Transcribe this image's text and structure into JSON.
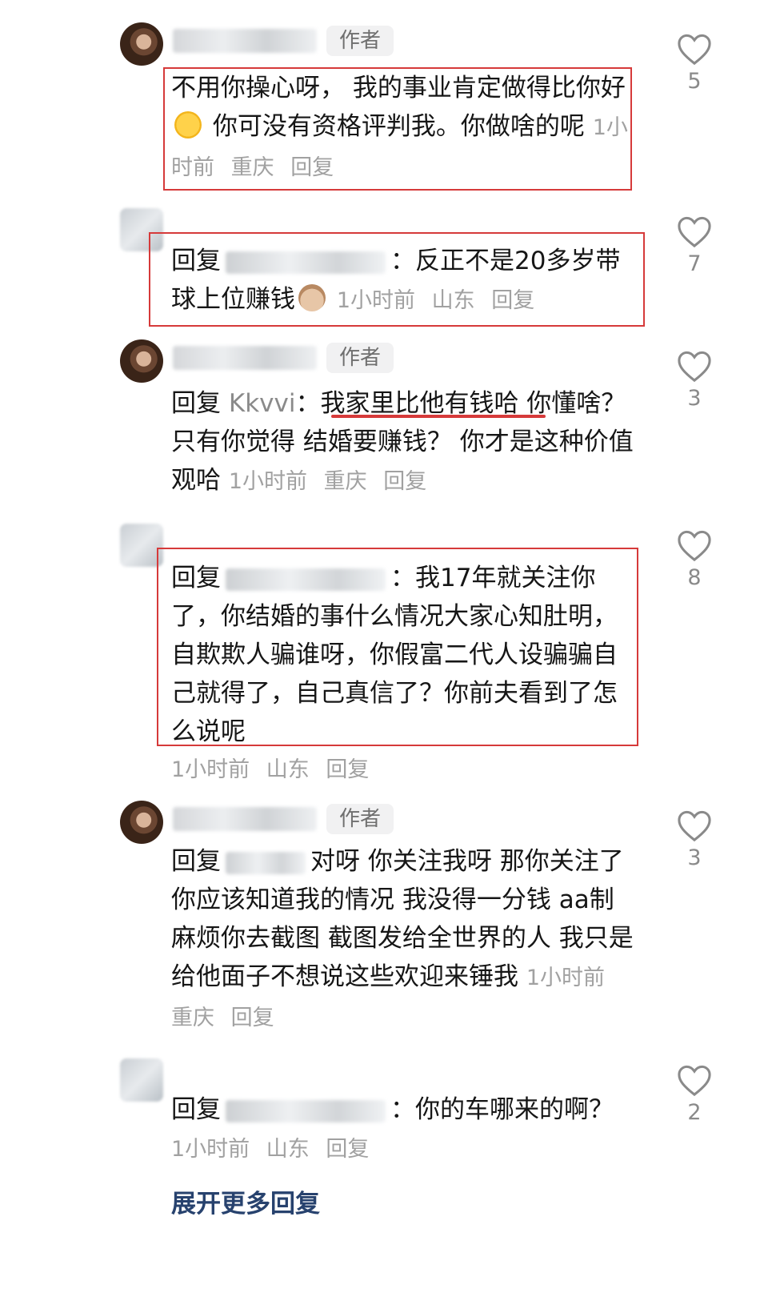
{
  "comments": [
    {
      "is_author": true,
      "author_badge": "作者",
      "reply_prefix": "",
      "text": "不用你操心呀， 我的事业肯定做得比你好",
      "emoji": "thinking-face-icon",
      "text_after_emoji": " 你可没有资格评判我。你做啥的呢",
      "time": "1小时前",
      "location": "重庆",
      "reply_label": "回复",
      "likes": "5"
    },
    {
      "is_author": false,
      "reply_prefix": "回复",
      "text": "：反正不是20多岁带球上位赚钱",
      "emoji": "poop-face-icon",
      "time": "1小时前",
      "location": "山东",
      "reply_label": "回复",
      "likes": "7"
    },
    {
      "is_author": true,
      "author_badge": "作者",
      "reply_prefix": "回复",
      "mention": "Kkvvi",
      "text": "：我家里比他有钱哈 你懂啥？ 只有你觉得 结婚要赚钱？ 你才是这种价值观哈",
      "time": "1小时前",
      "location": "重庆",
      "reply_label": "回复",
      "likes": "3"
    },
    {
      "is_author": false,
      "reply_prefix": "回复",
      "text": "：我17年就关注你了，你结婚的事什么情况大家心知肚明，自欺欺人骗谁呀，你假富二代人设骗骗自己就得了，自己真信了？你前夫看到了怎么说呢",
      "time": "1小时前",
      "location": "山东",
      "reply_label": "回复",
      "likes": "8"
    },
    {
      "is_author": true,
      "author_badge": "作者",
      "reply_prefix": "回复",
      "text": "对呀 你关注我呀 那你关注了你应该知道我的情况 我没得一分钱 aa制 麻烦你去截图 截图发给全世界的人 我只是给他面子不想说这些欢迎来锤我",
      "time": "1小时前",
      "location": "重庆",
      "reply_label": "回复",
      "likes": "3"
    },
    {
      "is_author": false,
      "reply_prefix": "回复",
      "text": "：你的车哪来的啊？",
      "time": "1小时前",
      "location": "山东",
      "reply_label": "回复",
      "likes": "2"
    }
  ],
  "expand_more": "展开更多回复",
  "colors": {
    "annotation": "#d63a3a",
    "link": "#27426e",
    "meta": "#a1a1a1"
  },
  "icons": {
    "like": "heart-outline-icon"
  }
}
